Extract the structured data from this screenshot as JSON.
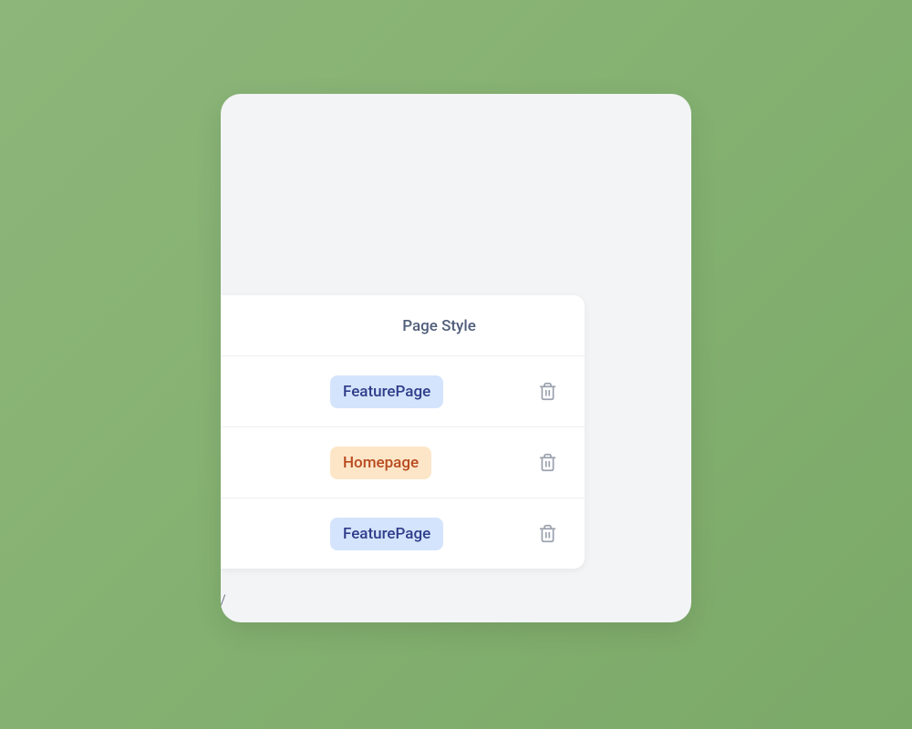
{
  "table": {
    "header": "Page Style",
    "rows": [
      {
        "badge": "FeaturePage",
        "variant": "blue"
      },
      {
        "badge": "Homepage",
        "variant": "orange"
      },
      {
        "badge": "FeaturePage",
        "variant": "blue"
      }
    ],
    "fragment": "/"
  }
}
